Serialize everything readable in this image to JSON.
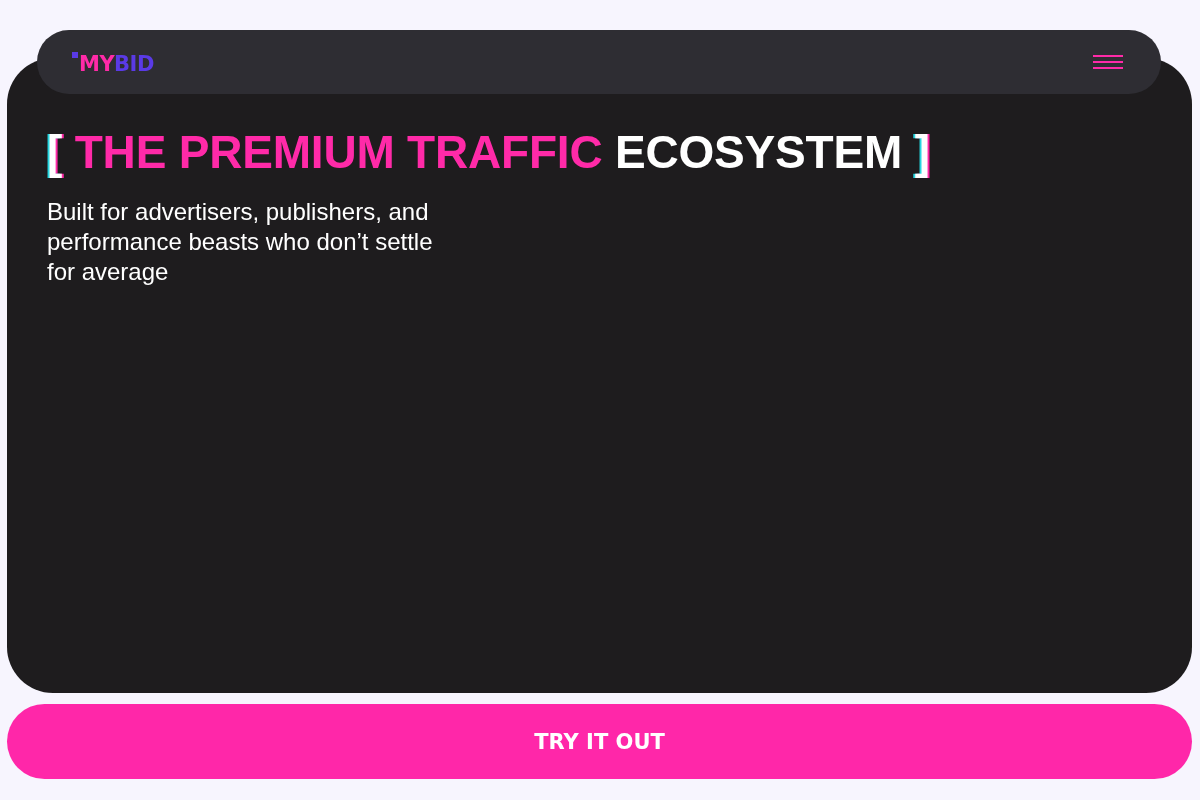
{
  "nav": {
    "logo": {
      "parts": [
        {
          "text": "MY",
          "color": "#ff2aa8"
        },
        {
          "text": "BID",
          "color": "#5a3ae6"
        }
      ]
    }
  },
  "hero": {
    "heading": [
      {
        "text": "[",
        "kind": "bracket"
      },
      {
        "text": "THE PREMIUM TRAFFIC",
        "kind": "accent"
      },
      {
        "text": "ECOSYSTEM",
        "kind": "plain"
      },
      {
        "text": "]",
        "kind": "bracket"
      }
    ],
    "subtitle": "Built for advertisers, publishers, and performance beasts who don’t settle for average"
  },
  "cta": {
    "label": "TRY IT OUT"
  }
}
